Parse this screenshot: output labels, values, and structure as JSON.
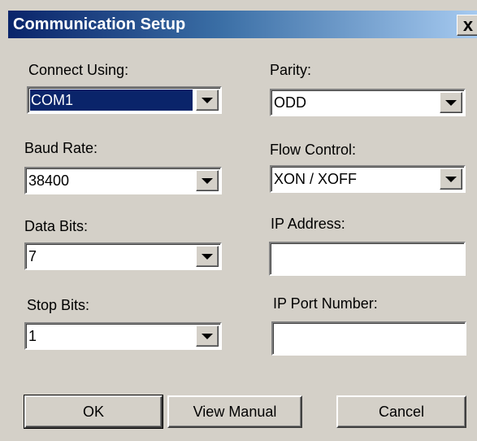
{
  "window": {
    "title": "Communication Setup",
    "close_icon": "✕",
    "close_symbol": "x"
  },
  "form": {
    "connect_using": {
      "label": "Connect Using:",
      "value": "COM1"
    },
    "parity": {
      "label": "Parity:",
      "value": "ODD"
    },
    "baud_rate": {
      "label": "Baud Rate:",
      "value": "38400"
    },
    "flow_control": {
      "label": "Flow Control:",
      "value": "XON / XOFF"
    },
    "data_bits": {
      "label": "Data Bits:",
      "value": "7"
    },
    "ip_address": {
      "label": "IP Address:",
      "value": ""
    },
    "stop_bits": {
      "label": "Stop Bits:",
      "value": "1"
    },
    "ip_port": {
      "label": "IP Port Number:",
      "value": ""
    }
  },
  "buttons": {
    "ok": "OK",
    "view_manual": "View Manual",
    "cancel": "Cancel"
  },
  "colors": {
    "face": "#d4d0c8",
    "title_start": "#0a246a",
    "title_end": "#a6caf0",
    "selection": "#0a246a"
  }
}
